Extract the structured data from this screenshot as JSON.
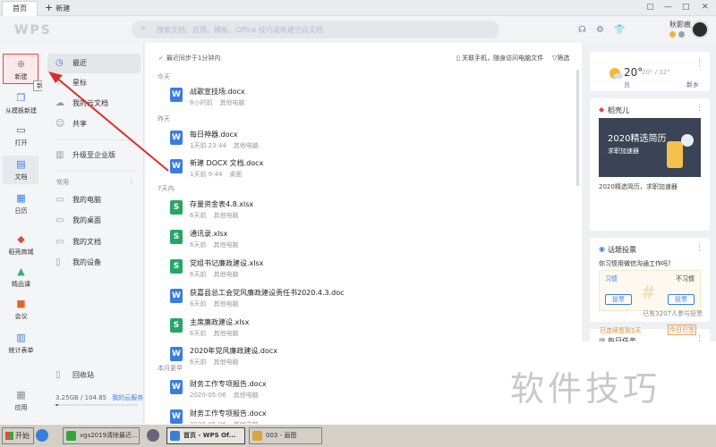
{
  "tabs": {
    "home": "首页",
    "new": "新建"
  },
  "header": {
    "logo": "WPS",
    "search_placeholder": "搜索文档、应用、模板、Office 技巧或新建空白文档",
    "username": "秋影痕"
  },
  "rail": {
    "new": "新建",
    "tooltip": "新建",
    "from_template": "从模板新建",
    "open": "打开",
    "docs": "文档",
    "calendar": "日历",
    "shop": "稻壳商城",
    "course": "精品课",
    "meeting": "会议",
    "forms": "统计表单",
    "apps": "应用"
  },
  "nav": {
    "recent": "最近",
    "starred": "星标",
    "my_cloud": "我的云文档",
    "shared": "共享",
    "upgrade": "升级至企业版",
    "common_label": "常用",
    "my_computer": "我的电脑",
    "my_desktop": "我的桌面",
    "my_documents": "我的文档",
    "my_devices": "我的设备",
    "recycle": "回收站",
    "storage": "3.25GB / 104.85",
    "storage_link": "我的云服务",
    "storage_used_fraction": 0.031
  },
  "content": {
    "sync": "最近同步于1分钟内",
    "link_phone": "关联手机，随身访问电脑文件",
    "filter": "筛选",
    "groups": {
      "today": "今天",
      "yesterday": "昨天",
      "week": "7天内",
      "earlier": "本月更早"
    },
    "files": [
      {
        "name": "战歌宣技场.docx",
        "time": "8小时前",
        "loc": "其他电脑",
        "type": "W"
      },
      {
        "name": "每日神器.docx",
        "time": "1天前 23:44",
        "loc": "其他电脑",
        "type": "W"
      },
      {
        "name": "新建 DOCX 文档.docx",
        "time": "1天前 9:44",
        "loc": "桌面",
        "type": "W"
      },
      {
        "name": "存量资金表4.8.xlsx",
        "time": "6天前",
        "loc": "其他电脑",
        "type": "S"
      },
      {
        "name": "通讯录.xlsx",
        "time": "6天前",
        "loc": "其他电脑",
        "type": "S"
      },
      {
        "name": "党组书记廉政建设.xlsx",
        "time": "6天前",
        "loc": "其他电脑",
        "type": "S"
      },
      {
        "name": "获嘉县总工会党风廉政建设责任书2020.4.3.doc",
        "time": "6天前",
        "loc": "其他电脑",
        "type": "W"
      },
      {
        "name": "主席廉政建设.xlsx",
        "time": "6天前",
        "loc": "其他电脑",
        "type": "S"
      },
      {
        "name": "2020年党风廉政建设.docx",
        "time": "6天前",
        "loc": "其他电脑",
        "type": "W"
      },
      {
        "name": "财务工作专项报告.docx",
        "time": "2020-05-06",
        "loc": "其他电脑",
        "type": "W"
      },
      {
        "name": "财务工作专项报告.docx",
        "time": "2020-05-06",
        "loc": "其他电脑",
        "type": "W"
      }
    ]
  },
  "weather": {
    "temp": "20°",
    "range": "20° / 32°",
    "quality": "良",
    "city": "新乡"
  },
  "promo": {
    "title": "稻壳儿",
    "banner_title": "2020精选简历",
    "banner_sub": "求职加速器",
    "caption": "2020精选简历，求职加速器"
  },
  "poll": {
    "title": "话题投票",
    "question": "你习惯用微信沟通工作吗？",
    "option_a": "习惯",
    "option_b": "不习惯",
    "vote": "投票",
    "count": "已有3207人参与投票"
  },
  "tasks": {
    "title": "每日任务",
    "status": "已连续签到1天",
    "checkin": "今日已签"
  },
  "watermark": "软件技巧",
  "taskbar": {
    "start": "开始",
    "items": [
      "vgs2019清除最近...",
      "首页 - WPS Of...",
      "003 - 画图"
    ]
  },
  "colors": {
    "accent": "#3b7ddd",
    "sheet": "#27a567",
    "arrow": "#d9302c"
  }
}
